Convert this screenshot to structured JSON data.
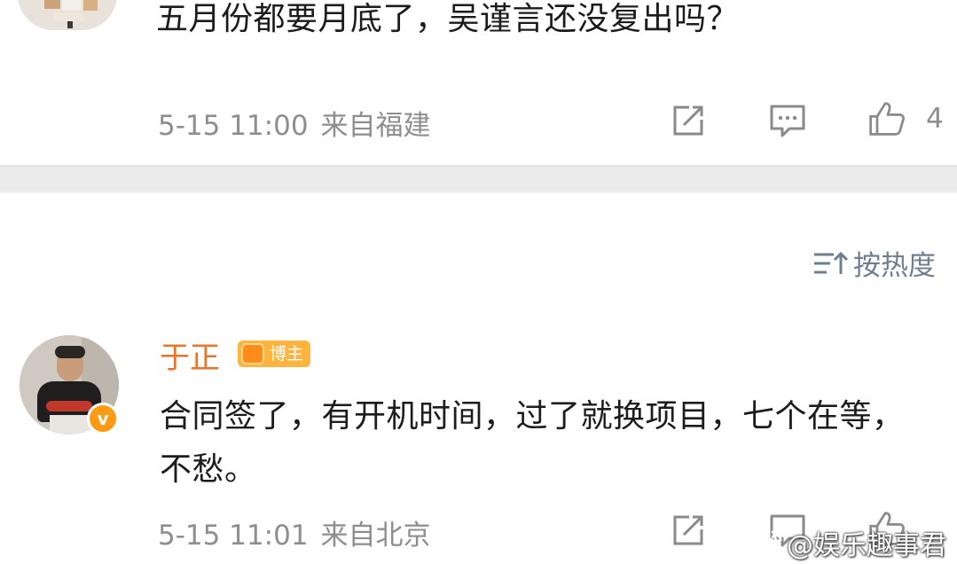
{
  "top_comment": {
    "text": "五月份都要月底了，吴谨言还没复出吗？",
    "time": "5-15 11:00",
    "location": "来自福建",
    "like_count": "4"
  },
  "sort": {
    "label": "按热度"
  },
  "reply": {
    "author": "于正",
    "badge": "博主",
    "verified_mark": "v",
    "text": "合同签了，有开机时间，过了就换项目，七个在等，不愁。",
    "time": "5-15 11:01",
    "location": "来自北京"
  },
  "watermark": {
    "text": "@娱乐趣事君"
  },
  "colors": {
    "author": "#e8742a",
    "badge": "#ffb53d",
    "meta": "#8e8e8e",
    "sort": "#6f7f8f",
    "divider": "#ececec"
  },
  "icons": [
    "share-icon",
    "comment-icon",
    "like-icon",
    "sort-icon",
    "weibo-logo-icon"
  ]
}
